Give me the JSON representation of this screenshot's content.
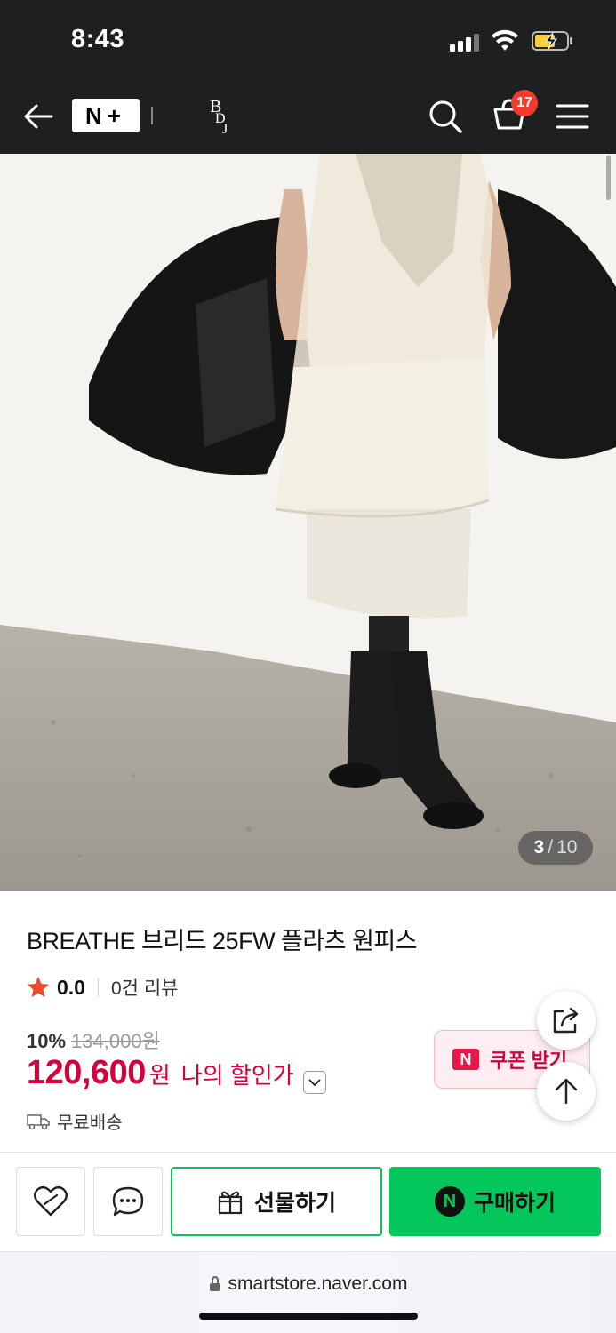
{
  "status_bar": {
    "time": "8:43"
  },
  "header": {
    "nplus_logo": "N+",
    "brand_logo": "BDJ",
    "cart_count": "17"
  },
  "image_counter": {
    "current": "3",
    "separator": "/",
    "total": "10"
  },
  "product": {
    "title": "BREATHE 브리드 25FW 플라츠 원피스",
    "rating": "0.0",
    "review_count": "0건 리뷰",
    "discount_rate": "10%",
    "original_price": "134,000원",
    "sale_price": "120,600",
    "currency": "원",
    "my_discount_label": "나의 할인가",
    "shipping": "무료배송"
  },
  "coupon": {
    "badge": "N",
    "label": "쿠폰 받기"
  },
  "bottom_bar": {
    "gift_label": "선물하기",
    "buy_badge": "N",
    "buy_label": "구매하기"
  },
  "browser": {
    "url": "smartstore.naver.com"
  },
  "colors": {
    "header_bg": "#1d1f21",
    "price_red": "#d6003b",
    "naver_green": "#03c75a",
    "badge_red": "#f03c2e"
  },
  "icons": [
    "back-arrow-icon",
    "search-icon",
    "cart-icon",
    "menu-icon",
    "star-icon",
    "chevron-down-icon",
    "truck-icon",
    "share-icon",
    "arrow-up-icon",
    "heart-icon",
    "chat-icon",
    "gift-icon",
    "lock-icon"
  ]
}
